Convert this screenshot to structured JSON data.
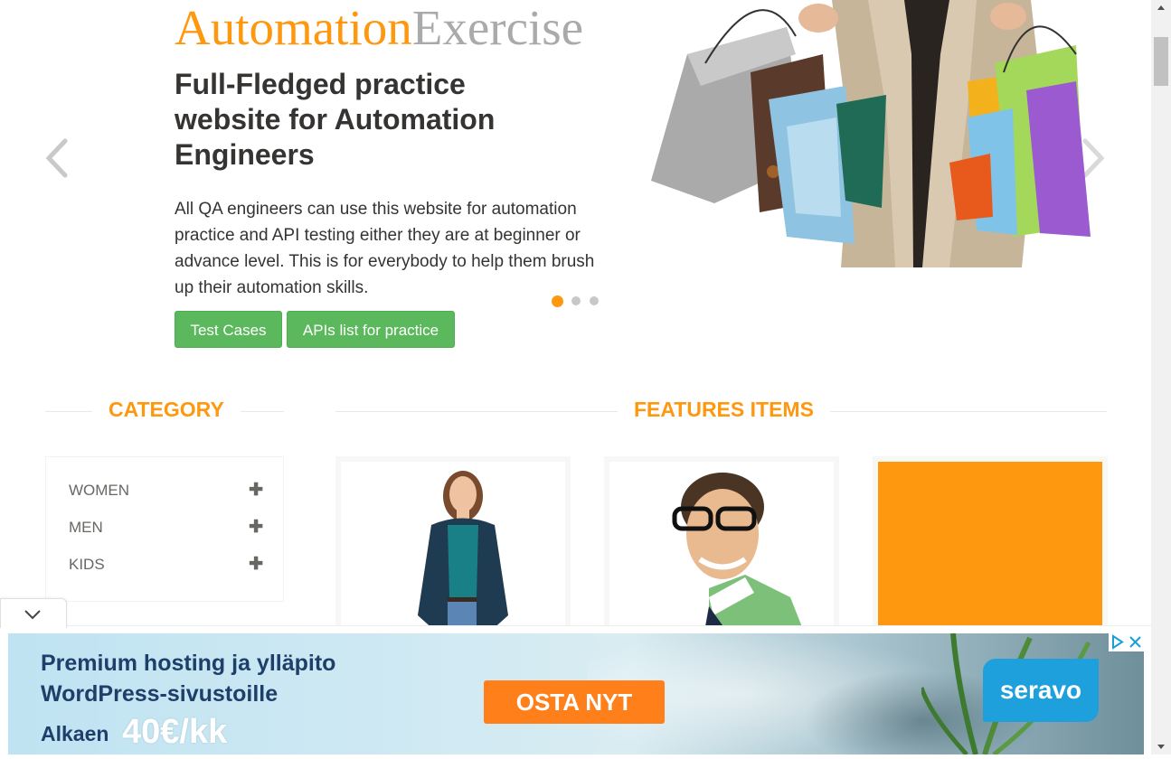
{
  "slider": {
    "brand_part1": "Automation",
    "brand_part2": "Exercise",
    "headline": "Full-Fledged practice website for Automation Engineers",
    "description": "All QA engineers can use this website for automation practice and API testing either they are at beginner or advance level. This is for everybody to help them brush up their automation skills.",
    "buttons": {
      "test_cases": "Test Cases",
      "apis_list": "APIs list for practice"
    },
    "active_slide": 1,
    "slide_count": 3
  },
  "category": {
    "title": "Category",
    "items": [
      {
        "label": "WOMEN",
        "icon": "plus-icon"
      },
      {
        "label": "MEN",
        "icon": "plus-icon"
      },
      {
        "label": "KIDS",
        "icon": "plus-icon"
      }
    ]
  },
  "features": {
    "title": "Features Items"
  },
  "ad": {
    "line1": "Premium hosting ja ylläpito",
    "line2": "WordPress-sivustoille",
    "from_label": "Alkaen",
    "price": "40€/kk",
    "cta": "OSTA NYT",
    "logo": "seravo"
  },
  "colors": {
    "brand_orange": "#FE980F",
    "button_green": "#5cb85c",
    "text_dark": "#363432",
    "ad_cta": "#ff7f1a",
    "ad_logo": "#1ea0dc"
  }
}
